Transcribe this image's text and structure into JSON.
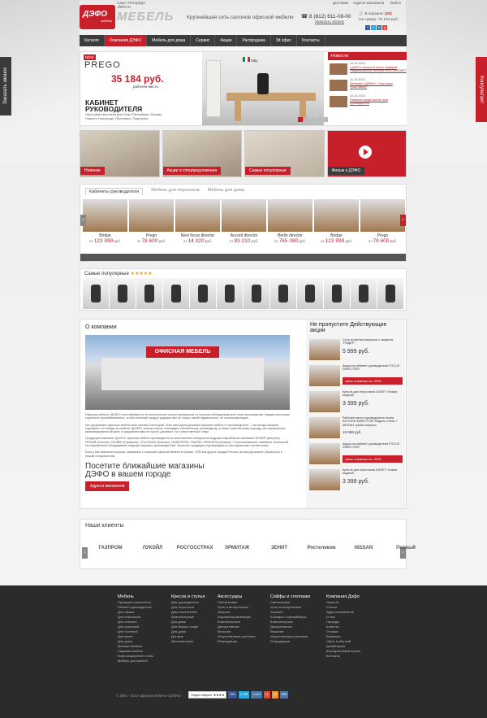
{
  "colors": {
    "brand": "#c8202a",
    "nav": "#3c3c3c",
    "footer": "#2b2b2b"
  },
  "sides": {
    "left": "Заказать звонок",
    "right": "Консультант"
  },
  "topline": {
    "city": "Санкт-Петербург",
    "delivery": "Доставка",
    "stores": "Адреса магазинов",
    "login": "Войти"
  },
  "header": {
    "logo": "ДЭФО",
    "logo_sub": "мебель",
    "url": "defo.ru",
    "brand": "МЕБЕЛЬ",
    "slogan": "Крупнейшая сеть салонов офисной мебели",
    "phone": "8 (812) 611-08-00",
    "callback": "Заказать звонок",
    "cart_label": "В корзине:",
    "cart_count": "(20)",
    "cart_sum": "На сумму: 78 234 руб."
  },
  "nav": [
    "Каталог",
    "Компания ДЭФО",
    "Мебель для дома",
    "Сервис",
    "Акции",
    "Распродажа",
    "3d офис",
    "Контакты"
  ],
  "hero": {
    "new": "NEW",
    "name": "PREGO",
    "price": "35 184 руб.",
    "price_sub": "рабочее место",
    "title1": "КАБИНЕТ",
    "title2": "РУКОВОДИТЕЛЯ",
    "sub": "*Цена действительна для Санкт-Петербурга, Москвы, Нижнего Новгорода, Ярославля, Подольска",
    "country": "Italy"
  },
  "news": {
    "title": "Новости",
    "items": [
      {
        "date": "15.10.2013",
        "text": "«ДЭФО» вошло в число лидеров Национального реестра #ПРОФСОВЕТ"
      },
      {
        "date": "11.10.2013",
        "text": "Феномен «ДЭФО». Участники «Выставки»"
      },
      {
        "date": "15.10.2013",
        "text": "Новинки среди кресел для руководителя"
      }
    ]
  },
  "promos": [
    "Новинки",
    "Акции и спецпредложения",
    "Самые популярные",
    "Фильм о ДЭФО"
  ],
  "tabs": [
    "Кабинеты руководителя",
    "Мебель для персонала",
    "Мебель для дома"
  ],
  "products": [
    {
      "name": "Bridge",
      "price": "123 999"
    },
    {
      "name": "Prego",
      "price": "78 600"
    },
    {
      "name": "New focus director",
      "price": "14 320"
    },
    {
      "name": "Accord director",
      "price": "83 210"
    },
    {
      "name": "Berlin director",
      "price": "765 080"
    },
    {
      "name": "Bridge",
      "price": "123 999"
    },
    {
      "name": "Prego",
      "price": "78 600"
    }
  ],
  "price_from": "от",
  "currency": "руб.",
  "popular": {
    "title": "Самые популярные",
    "stars": "★★★★★"
  },
  "about": {
    "title": "О компании",
    "sign": "ОФИСНАЯ МЕБЕЛЬ",
    "p1": "Офисная мебель «ДЭФО» изготавливается из экологически чистых материалов со строгим соблюдением всех норм производства. Каждая коллекция тщательно прорабатывается, чтобы конечный продукт радовал вас не только своей надежностью, но и внешним видом.",
    "p2": "Мы предлагаем офисную мебель всех ценовых категорий. Если вам нужна дешевая офисная мебель от производителя — вы всегда сможете подобрать что-нибудь из мебели «ДЭФО» эконом класса. Благодаря собственному производству, а также комплексному подходу, мы максимально минимизировали затраты и предлагаем вам не просто дешевые, но и качественный товар.",
    "p3": "Продукция компании «ДЭФО» офисная мебель производится из качественных материалов ведущих европейских компаний: EGGER (Австрия), FIEMME (Италия), FAUBER (Германия), STILLEMAN (Бельгия), MOBIFERRA, FAVERO, PREZIOSA (Италия). С использованием новейших технологий, на современном оборудовании ведущих мировых производителей. Качество продукции подтверждается сертификатами соответствия.",
    "p4": "Если у вас возникли вопросы, связанные с покупкой офисной мебели в Москве, СПб или других городах России, вы всегда можете обратиться к нашим специалистам.",
    "visit": "Посетите ближайшие магазины ДЭФО в вашем городе",
    "visit_btn": "Адреса магазинов"
  },
  "actions": {
    "title": "Не пропустите Действующие акции",
    "items": [
      {
        "title": "Стол из металлокаркаса с экраном \"РИДЕР\"",
        "price": "5 999 руб.",
        "badge": ""
      },
      {
        "title": "Акция на кабинет руководителя FOCUS DIRECTOR!",
        "price": "",
        "badge": "Цены снижены на -20%!"
      },
      {
        "title": "Кресла для персонала ASSET! Новые модели!",
        "price": "3 399 руб.",
        "badge": ""
      },
      {
        "title": "Рабочее место руководителя серии ACCORD-DIRECTOR! Модель стола + ABTD81 тумба опорная",
        "price": "19 999 руб.",
        "badge": ""
      },
      {
        "title": "Акция на кабинет руководителя FOCUS DIRECTOR!",
        "price": "",
        "badge": "Цены снижены на -20%!"
      },
      {
        "title": "Кресла для персонала ASSET! Новые модели!",
        "price": "3 399 руб.",
        "badge": ""
      }
    ]
  },
  "clients": {
    "title": "Наши клиенты",
    "items": [
      "ГАЗПРОМ",
      "ЛУКОЙЛ",
      "РОСГОССТРАХ",
      "ЭРМИТАЖ",
      "ЗЕНИТ",
      "Ростелеком",
      "NISSAN",
      "Первый"
    ]
  },
  "footer": {
    "cols": [
      {
        "title": "Мебель",
        "items": [
          "Президент комплекты",
          "Кабинет руководителя",
          "Для офиса",
          "Для персонала",
          "Для спальни",
          "Для прихожей",
          "Для гостиной",
          "Для кухни",
          "Для дома",
          "Магазин мебели",
          "Садовая мебель",
          "Композиционные столы",
          "Мебель для ванной"
        ]
      },
      {
        "title": "Кресла и стулья",
        "items": [
          "Для руководителя",
          "Для персонала",
          "Для посетителей",
          "Компьютерные",
          "Для дома",
          "Для баров и кафе",
          "Для дома",
          "Детские",
          "Многоместные"
        ]
      },
      {
        "title": "Аксессуары",
        "items": [
          "Светильники",
          "Урны и ветерничные",
          "Зеркала",
          "Корзины/органайзеры",
          "Компьютерные",
          "Декоративные",
          "Вешалки",
          "Искусственные растения",
          "Репродукции"
        ]
      },
      {
        "title": "Сейфы и стеллажи",
        "items": [
          "Светильники",
          "Урны и ветерничные",
          "Зеркала",
          "Блокиры и органайзеры",
          "Компьютерные",
          "Декоративные",
          "Вешалки",
          "Искусственные растения",
          "Репродукции"
        ]
      },
      {
        "title": "Компания Дэфо",
        "items": [
          "Новости",
          "Статьи",
          "Адреса магазинов",
          "О нас",
          "Награды",
          "Клиенты",
          "Отзывы",
          "Вакансии",
          "Офис в убыткой",
          "Дизайнерам",
          "Корпоративный проект",
          "Контакты"
        ]
      }
    ],
    "copy": "© 1991 - 2013 офисная мебель «ДЭФО»",
    "market": "Яндекс.Маркет ★★★★",
    "counters": [
      "341",
      "1 728",
      "1 523",
      "11",
      "56",
      "535"
    ]
  }
}
